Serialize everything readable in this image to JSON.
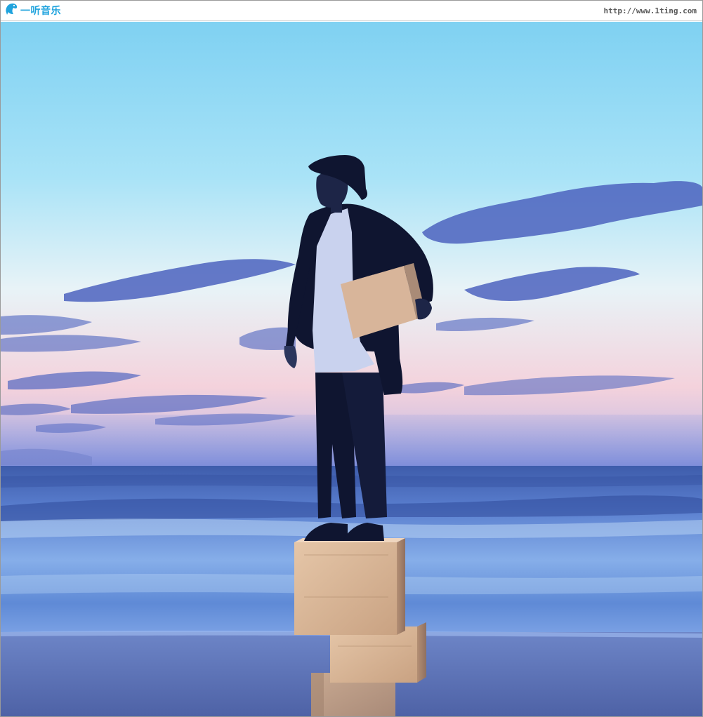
{
  "brand": {
    "logo_icon": "dolphin-logo-icon",
    "name": "一听音乐",
    "color": "#1fa3dd"
  },
  "watermark": {
    "url": "http://www.1ting.com"
  },
  "photo": {
    "description_icon": "man-on-stacked-boxes-photo",
    "colors": {
      "sky_top": "#7fd1f2",
      "horizon_glow": "#f4d2dc",
      "sea": "#4a6fc2",
      "sand": "#5b72b7",
      "boxes": "#d9b89a",
      "silhouette": "#0f1530"
    }
  }
}
